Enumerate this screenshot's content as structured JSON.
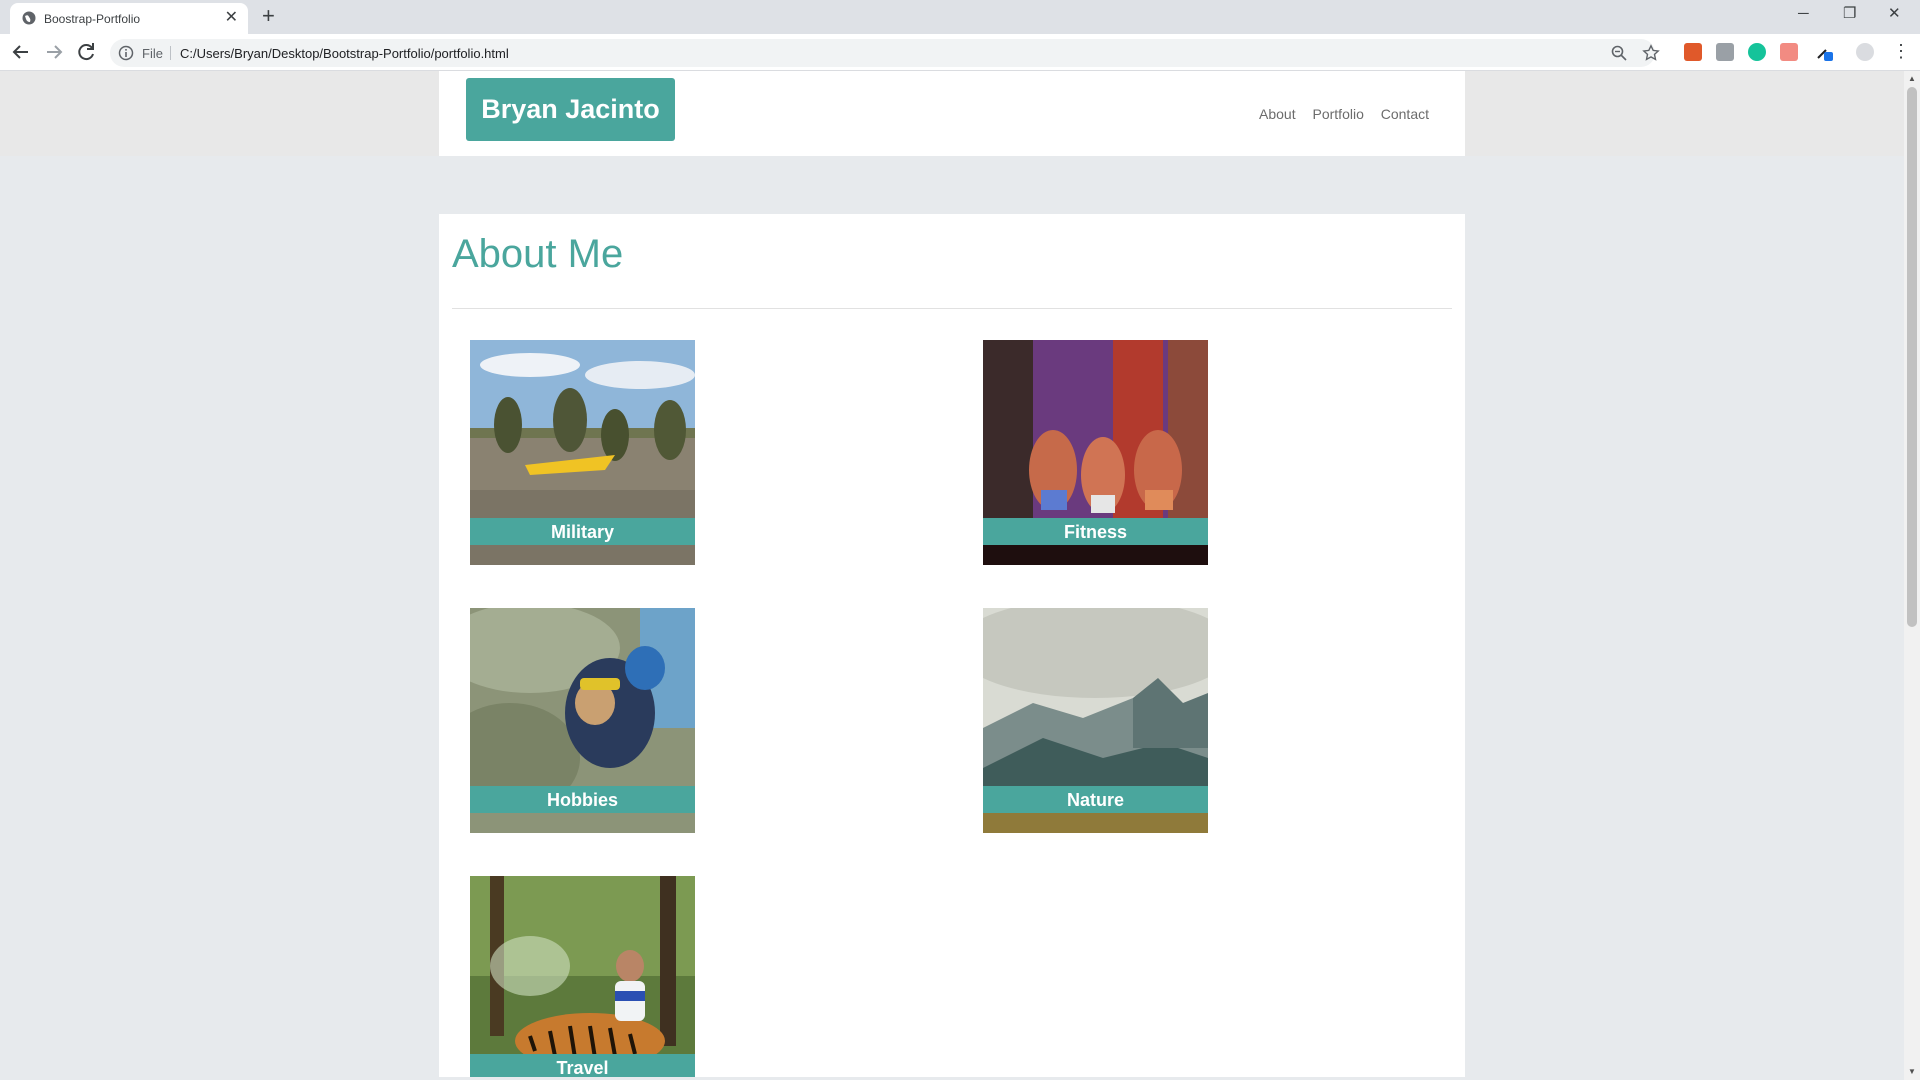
{
  "browser": {
    "tab_title": "Boostrap-Portfolio",
    "url_scheme": "File",
    "url": "C:/Users/Bryan/Desktop/Bootstrap-Portfolio/portfolio.html"
  },
  "site": {
    "brand": "Bryan Jacinto",
    "nav": [
      "About",
      "Portfolio",
      "Contact"
    ]
  },
  "main": {
    "title": "About Me",
    "cards": [
      {
        "caption": "Military",
        "image": "soldiers-in-camouflage-photo"
      },
      {
        "caption": "Fitness",
        "image": "bodybuilding-stage-photo"
      },
      {
        "caption": "Hobbies",
        "image": "skydiving-photo"
      },
      {
        "caption": "Nature",
        "image": "mountain-valley-photo"
      },
      {
        "caption": "Travel",
        "image": "tiger-photo"
      }
    ]
  },
  "colors": {
    "accent": "#4aa69d",
    "page_bg": "#e7eaed"
  }
}
